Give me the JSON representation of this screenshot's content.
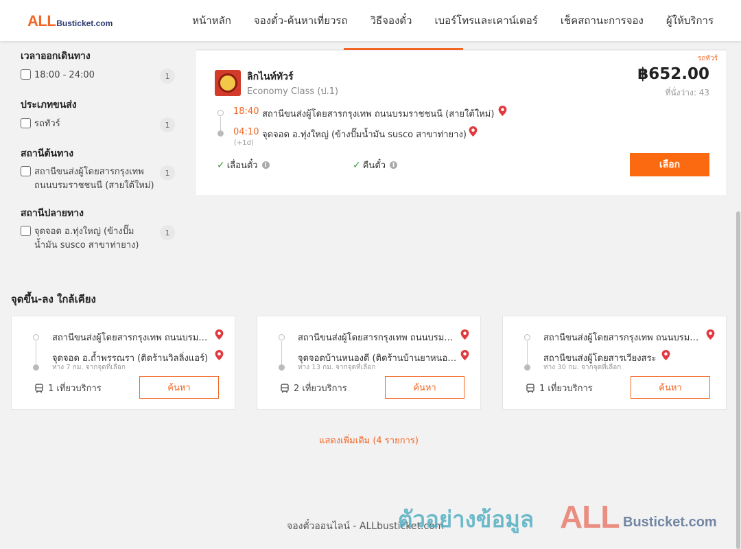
{
  "header": {
    "logo_all": "ALL",
    "logo_rest": "Busticket.com",
    "nav": [
      "หน้าหลัก",
      "จองตั๋ว-ค้นหาเที่ยวรถ",
      "วิธีจองตั๋ว",
      "เบอร์โทรและเคาน์เตอร์",
      "เช็คสถานะการจอง",
      "ผู้ให้บริการ"
    ]
  },
  "filters": {
    "departure_time": {
      "title": "เวลาออกเดินทาง",
      "label": "18:00 - 24:00",
      "count": "1"
    },
    "bus_type": {
      "title": "ประเภทขนส่ง",
      "label": "รถทัวร์",
      "count": "1"
    },
    "origin": {
      "title": "สถานีต้นทาง",
      "label": "สถานีขนส่งผู้โดยสารกรุงเทพ ถนนบรมราชชนนี (สายใต้ใหม่)",
      "count": "1"
    },
    "destination": {
      "title": "สถานีปลายทาง",
      "label": "จุดจอด อ.ทุ่งใหญ่ (ข้างปั๊มน้ำมัน susco สาขาท่ายาง)",
      "count": "1"
    }
  },
  "trip": {
    "tag": "รถทัวร์",
    "operator": "ลิกไนท์ทัวร์",
    "class": "Economy Class (ป.1)",
    "price": "฿652.00",
    "seats": "ที่นั่งว่าง: 43",
    "depart_time": "18:40",
    "depart_stop": "สถานีขนส่งผู้โดยสารกรุงเทพ ถนนบรมราชชนนี (สายใต้ใหม่)",
    "arrive_time": "04:10",
    "arrive_stop": "จุดจอด อ.ทุ่งใหญ่ (ข้างปั๊มน้ำมัน susco สาขาท่ายาง)",
    "next_day": "(+1d)",
    "feature_reschedule": "เลื่อนตั๋ว",
    "feature_refund": "คืนตั๋ว",
    "select_label": "เลือก"
  },
  "nearby": {
    "title": "จุดขึ้น-ลง ใกล้เคียง",
    "cards": [
      {
        "from": "สถานีขนส่งผู้โดยสารกรุงเทพ ถนนบรมราชชนนี (สายใต้ใหม่)",
        "to": "จุดจอด อ.ถ้ำพรรณรา (ติดร้านวิลลิ่งแอร์)",
        "distance": "ห่าง 7 กม. จากจุดที่เลือก",
        "trips": "1 เที่ยวบริการ",
        "button": "ค้นหา"
      },
      {
        "from": "สถานีขนส่งผู้โดยสารกรุงเทพ ถนนบรมราชชนนี (สายใต้ใหม่)",
        "to": "จุดจอดบ้านหนองดี (ติดร้านบ้านยาหนองดี)",
        "distance": "ห่าง 13 กม. จากจุดที่เลือก",
        "trips": "2 เที่ยวบริการ",
        "button": "ค้นหา"
      },
      {
        "from": "สถานีขนส่งผู้โดยสารกรุงเทพ ถนนบรมราชชนนี (สายใต้ใหม่)",
        "to": "สถานีขนส่งผู้โดยสารเวียงสระ",
        "distance": "ห่าง 30 กม. จากจุดที่เลือก",
        "trips": "1 เที่ยวบริการ",
        "button": "ค้นหา"
      }
    ],
    "more": "แสดงเพิ่มเติม (4 รายการ)"
  },
  "footer": {
    "text": "จองตั๋วออนไลน์ - ALLbusticket.com"
  },
  "watermark": {
    "text": "ตัวอย่างข้อมูล",
    "all": "ALL",
    "rest": "Busticket.com"
  },
  "colors": {
    "accent": "#f26522",
    "button": "#fb6a10",
    "check": "#3a9b3a",
    "pin": "#e0393e"
  }
}
